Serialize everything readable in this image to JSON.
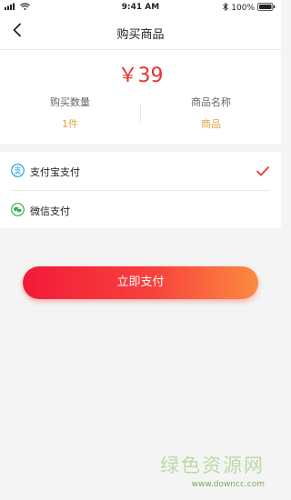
{
  "status_bar": {
    "time": "9:41 AM",
    "battery": "100%"
  },
  "nav": {
    "title": "购买商品"
  },
  "summary": {
    "price": "￥39",
    "quantity_label": "购买数量",
    "quantity_value": "1件",
    "name_label": "商品名称",
    "name_value": "商品"
  },
  "payment_methods": [
    {
      "label": "支付宝支付",
      "icon": "alipay-icon",
      "selected": true
    },
    {
      "label": "微信支付",
      "icon": "wechat-pay-icon",
      "selected": false
    }
  ],
  "pay_button": {
    "label": "立即支付"
  },
  "watermark": {
    "brand": "绿色资源网",
    "url": "www.downcc.com"
  },
  "colors": {
    "accent": "#e8332b",
    "value": "#e1a045",
    "button_start": "#f21b39",
    "button_end": "#fb8b40",
    "alipay": "#1a9bd7",
    "wechat": "#2bad4a"
  }
}
